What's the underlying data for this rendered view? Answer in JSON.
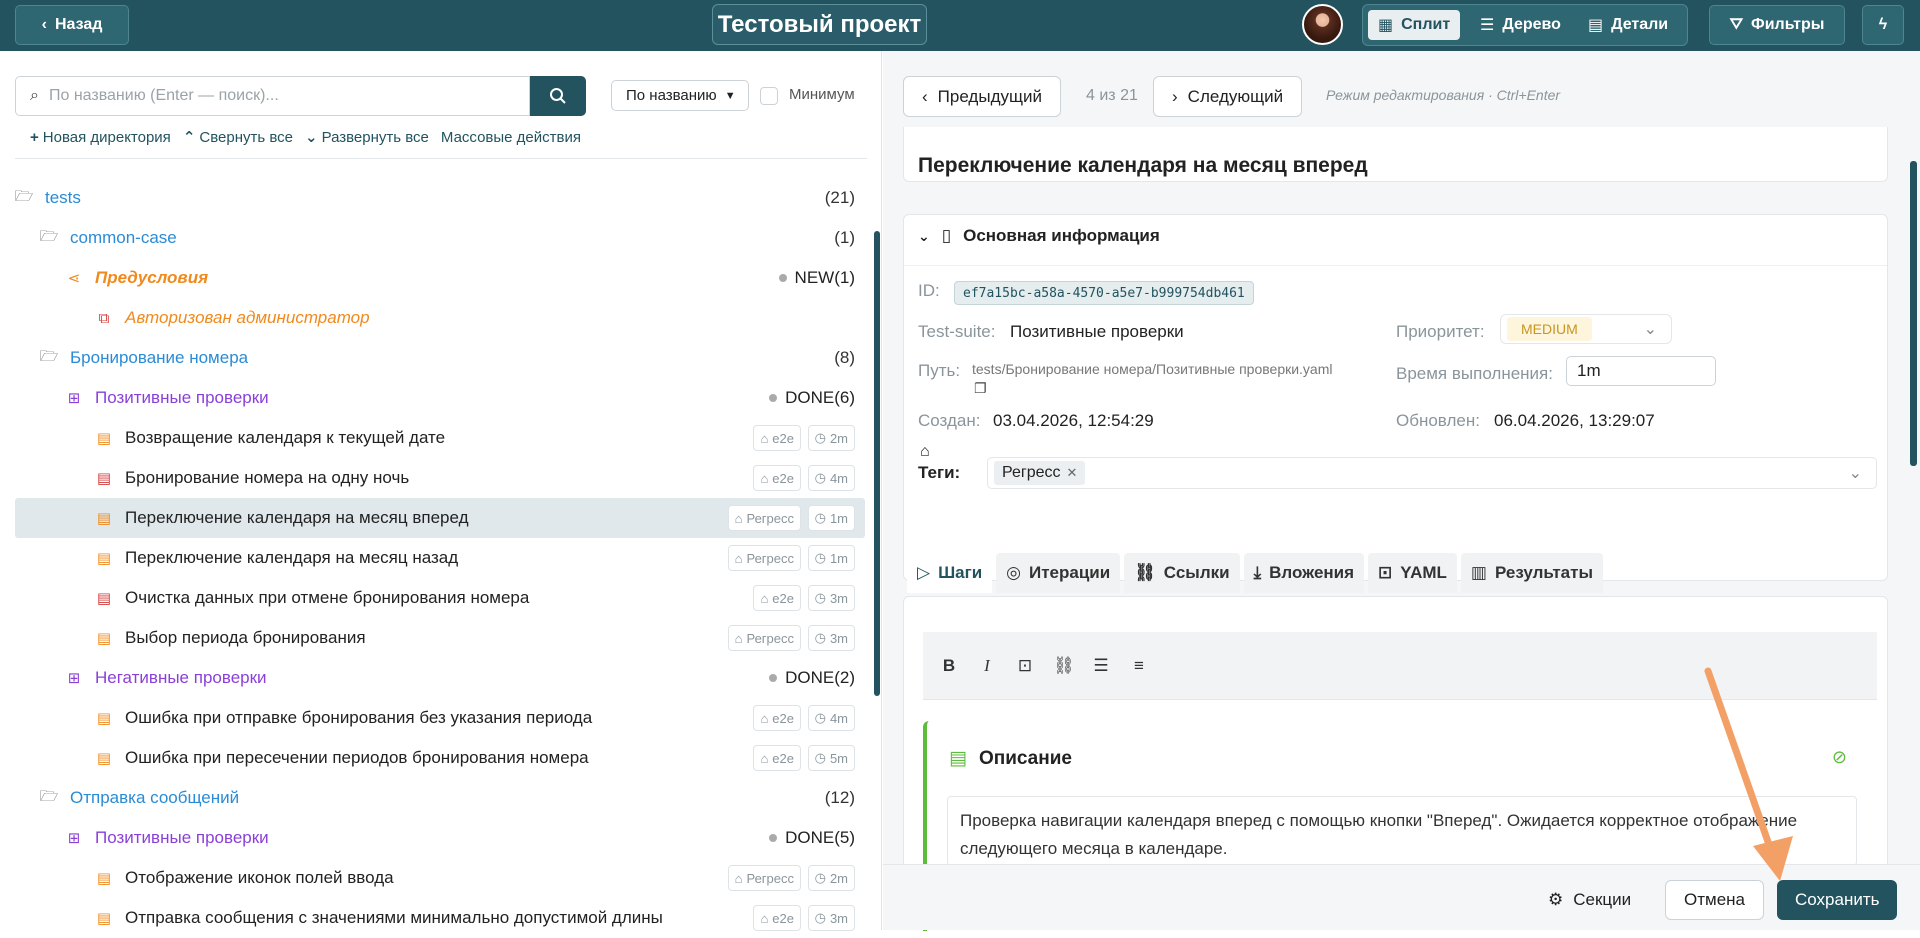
{
  "header": {
    "back_label": "Назад",
    "project_title": "Тестовый проект",
    "views": [
      "Сплит",
      "Дерево",
      "Детали"
    ],
    "filters_label": "Фильтры"
  },
  "search": {
    "placeholder": "По названию (Enter — поиск)...",
    "sort_value": "По названию",
    "minimum_label": "Минимум"
  },
  "toolbar": {
    "new_dir": "Новая директория",
    "collapse_all": "Свернуть все",
    "expand_all": "Развернуть все",
    "bulk": "Массовые действия"
  },
  "tree": [
    {
      "label": "tests",
      "count": "(21)",
      "kind": "dir"
    },
    {
      "label": "common-case",
      "count": "(1)",
      "kind": "dir"
    },
    {
      "label": "Предусловия",
      "status": "NEW",
      "count": "(1)",
      "kind": "precond"
    },
    {
      "label": "Авторизован администратор",
      "kind": "precond-item"
    },
    {
      "label": "Бронирование номера",
      "count": "(8)",
      "kind": "dir"
    },
    {
      "label": "Позитивные проверки",
      "status": "DONE",
      "count": "(6)",
      "kind": "suite"
    },
    {
      "label": "Возвращение календаря к текущей дате",
      "tag": "e2e",
      "time": "2m",
      "kind": "case"
    },
    {
      "label": "Бронирование номера на одну ночь",
      "tag": "e2e",
      "time": "4m",
      "kind": "case-red"
    },
    {
      "label": "Переключение календаря на месяц вперед",
      "tag": "Регресс",
      "time": "1m",
      "kind": "case",
      "selected": true
    },
    {
      "label": "Переключение календаря на месяц назад",
      "tag": "Регресс",
      "time": "1m",
      "kind": "case"
    },
    {
      "label": "Очистка данных при отмене бронирования номера",
      "tag": "e2e",
      "time": "3m",
      "kind": "case-red"
    },
    {
      "label": "Выбор периода бронирования",
      "tag": "Регресс",
      "time": "3m",
      "kind": "case"
    },
    {
      "label": "Негативные проверки",
      "status": "DONE",
      "count": "(2)",
      "kind": "suite"
    },
    {
      "label": "Ошибка при отправке бронирования без указания периода",
      "tag": "e2e",
      "time": "4m",
      "kind": "case"
    },
    {
      "label": "Ошибка при пересечении периодов бронирования номера",
      "tag": "e2e",
      "time": "5m",
      "kind": "case"
    },
    {
      "label": "Отправка сообщений",
      "count": "(12)",
      "kind": "dir"
    },
    {
      "label": "Позитивные проверки",
      "status": "DONE",
      "count": "(5)",
      "kind": "suite"
    },
    {
      "label": "Отображение иконок полей ввода",
      "tag": "Регресс",
      "time": "2m",
      "kind": "case"
    },
    {
      "label": "Отправка сообщения с значениями минимально допустимой длины",
      "tag": "e2e",
      "time": "3m",
      "kind": "case"
    }
  ],
  "nav": {
    "prev": "Предыдущий",
    "counter": "4 из 21",
    "next": "Следующий",
    "hint": "Режим редактирования · Ctrl+Enter"
  },
  "testcase": {
    "title": "Переключение календаря на месяц вперед",
    "section_title": "Основная информация",
    "id_label": "ID:",
    "id": "ef7a15bc-a58a-4570-a5e7-b999754db461",
    "suite_label": "Test-suite:",
    "suite": "Позитивные проверки",
    "priority_label": "Приоритет:",
    "priority": "MEDIUM",
    "path_label": "Путь:",
    "path": "tests/Бронирование номера/Позитивные проверки.yaml",
    "time_label": "Время выполнения:",
    "time": "1m",
    "created_label": "Создан:",
    "created": "03.04.2026, 12:54:29",
    "updated_label": "Обновлен:",
    "updated": "06.04.2026, 13:29:07",
    "tags_label": "Теги:",
    "tag": "Регресс"
  },
  "tabs": [
    "Шаги",
    "Итерации",
    "Ссылки",
    "Вложения",
    "YAML",
    "Результаты"
  ],
  "description": {
    "title": "Описание",
    "text": "Проверка навигации календаря вперед с помощью кнопки \"Вперед\". Ожидается корректное отображение следующего месяца в календаре."
  },
  "footer": {
    "sections": "Секции",
    "cancel": "Отмена",
    "save": "Сохранить"
  },
  "colors": {
    "header_bg": "#22535f",
    "dir": "#2a8bd6",
    "suite": "#8b3fd9",
    "precond": "#f08a1c",
    "accent": "#22535f",
    "arrow": "#f3a066"
  }
}
